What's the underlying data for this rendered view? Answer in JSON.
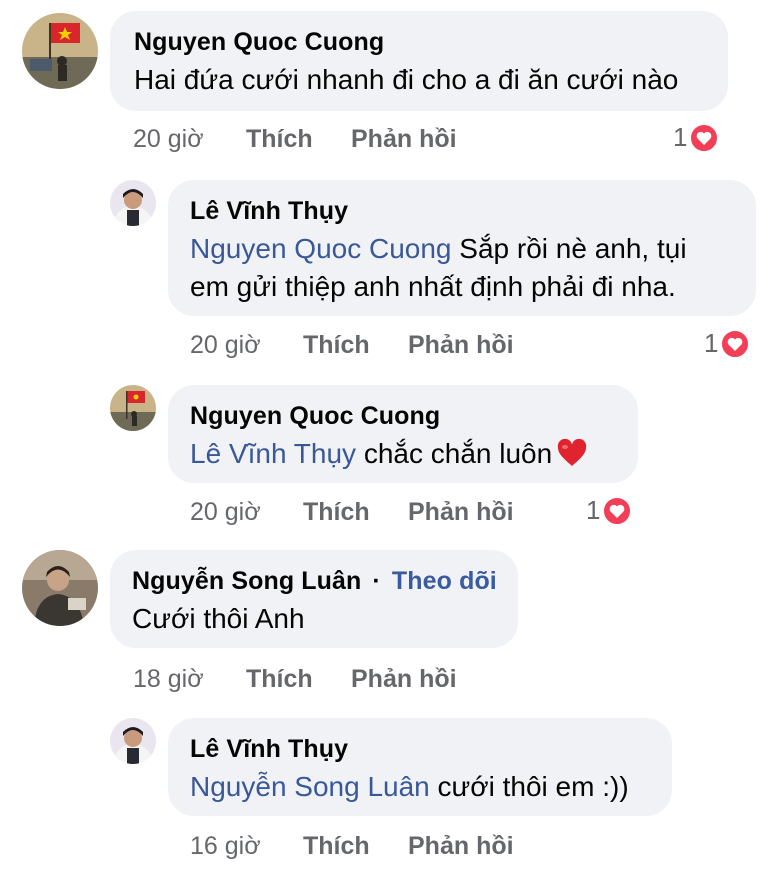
{
  "comments": [
    {
      "author": "Nguyen Quoc Cuong",
      "text": "Hai đứa cưới nhanh đi cho a đi ăn cưới nào",
      "time": "20 giờ",
      "like": "Thích",
      "reply": "Phản hồi",
      "reaction_count": "1"
    },
    {
      "author": "Lê Vĩnh Thụy",
      "mention": "Nguyen Quoc Cuong",
      "text_line1": " Sắp rồi nè anh, tụi",
      "text_line2": "em gửi thiệp anh nhất định phải đi nha.",
      "time": "20 giờ",
      "like": "Thích",
      "reply": "Phản hồi",
      "reaction_count": "1"
    },
    {
      "author": "Nguyen Quoc Cuong",
      "mention": "Lê Vĩnh Thụy",
      "text": " chắc chắn luôn",
      "time": "20 giờ",
      "like": "Thích",
      "reply": "Phản hồi",
      "reaction_count": "1"
    },
    {
      "author": "Nguyễn Song Luân",
      "separator": "·",
      "follow": "Theo dõi",
      "text": "Cưới thôi Anh",
      "time": "18 giờ",
      "like": "Thích",
      "reply": "Phản hồi"
    },
    {
      "author": "Lê Vĩnh Thụy",
      "mention": "Nguyễn Song Luân",
      "text": " cưới thôi em :))",
      "time": "16 giờ",
      "like": "Thích",
      "reply": "Phản hồi"
    }
  ],
  "colors": {
    "bubble": "#f0f2f5",
    "mention": "#385898",
    "meta": "#65676b",
    "heart": "#f33e58"
  },
  "icons": {
    "love_reaction": "heart-reaction-icon",
    "inline_heart": "red-heart-emoji-icon"
  }
}
